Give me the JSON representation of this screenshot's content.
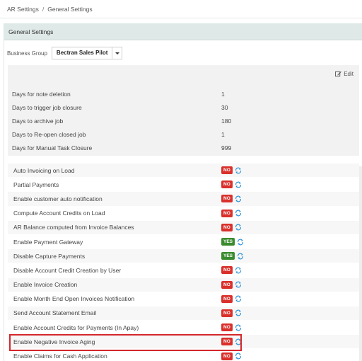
{
  "breadcrumb": {
    "parent": "AR Settings",
    "separator": "/",
    "current": "General Settings"
  },
  "panel": {
    "title": "General Settings"
  },
  "business_group": {
    "label": "Business Group",
    "value": "Bectran Sales Pilot"
  },
  "settings": {
    "edit_label": "Edit",
    "rows": [
      {
        "label": "Days for note deletion",
        "value": "1"
      },
      {
        "label": "Days to trigger job closure",
        "value": "30"
      },
      {
        "label": "Days to archive job",
        "value": "180"
      },
      {
        "label": "Days to Re-open closed job",
        "value": "1"
      },
      {
        "label": "Days for Manual Task Closure",
        "value": "999"
      }
    ]
  },
  "toggles": [
    {
      "label": "Auto Invoicing on Load",
      "status": "NO"
    },
    {
      "label": "Partial Payments",
      "status": "NO"
    },
    {
      "label": "Enable customer auto notification",
      "status": "NO"
    },
    {
      "label": "Compute Account Credits on Load",
      "status": "NO"
    },
    {
      "label": "AR Balance computed from Invoice Balances",
      "status": "NO"
    },
    {
      "label": "Enable Payment Gateway",
      "status": "YES"
    },
    {
      "label": "Disable Capture Payments",
      "status": "YES"
    },
    {
      "label": "Disable Account Credit Creation by User",
      "status": "NO"
    },
    {
      "label": "Enable Invoice Creation",
      "status": "NO"
    },
    {
      "label": "Enable Month End Open Invoices Notification",
      "status": "NO"
    },
    {
      "label": "Send Account Statement Email",
      "status": "NO"
    },
    {
      "label": "Enable Account Credits for Payments (In Apay)",
      "status": "NO"
    },
    {
      "label": "Enable Negative Invoice Aging",
      "status": "NO"
    },
    {
      "label": "Enable Claims for Cash Application",
      "status": "NO"
    }
  ],
  "colors": {
    "no_badge": "#d9302b",
    "yes_badge": "#3a8a2e",
    "sync_icon": "#2a8fd6",
    "highlight": "#d4272b",
    "panel_header": "#dfe9e7"
  },
  "icons": {
    "edit": "edit-icon",
    "sync": "sync-icon",
    "dropdown": "chevron-down-icon"
  }
}
